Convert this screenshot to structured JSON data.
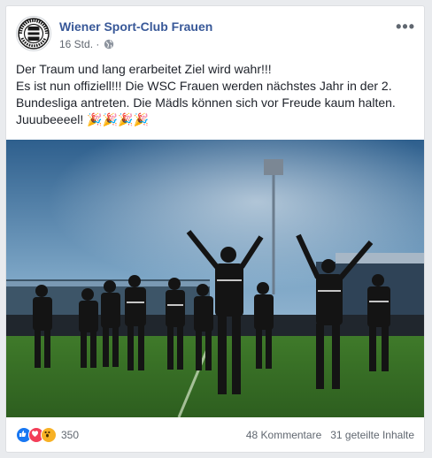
{
  "post": {
    "page_name": "Wiener Sport-Club Frauen",
    "time": "16 Std. ·",
    "text_lines": [
      "Der Traum und lang erarbeitet Ziel wird wahr!!!",
      "Es ist nun offiziell!!! Die WSC Frauen werden nächstes Jahr in der 2.",
      "Bundesliga antreten. Die Mädls können sich vor Freude kaum halten.",
      "Juuubeeeel! 🎉🎉🎉🎉"
    ],
    "more_label": "•••"
  },
  "logo": {
    "top_text": "WIENERSPORT",
    "bottom_text": "FRAUEN"
  },
  "footer": {
    "reaction_count": "350",
    "comments": "48 Kommentare",
    "shares": "31 geteilte Inhalte"
  },
  "colors": {
    "link": "#385898",
    "like": "#1877f2",
    "love": "#f33e58",
    "wow": "#f7b125"
  },
  "icons": [
    "globe-icon",
    "like-reaction-icon",
    "love-reaction-icon",
    "wow-reaction-icon",
    "more-options-icon"
  ]
}
